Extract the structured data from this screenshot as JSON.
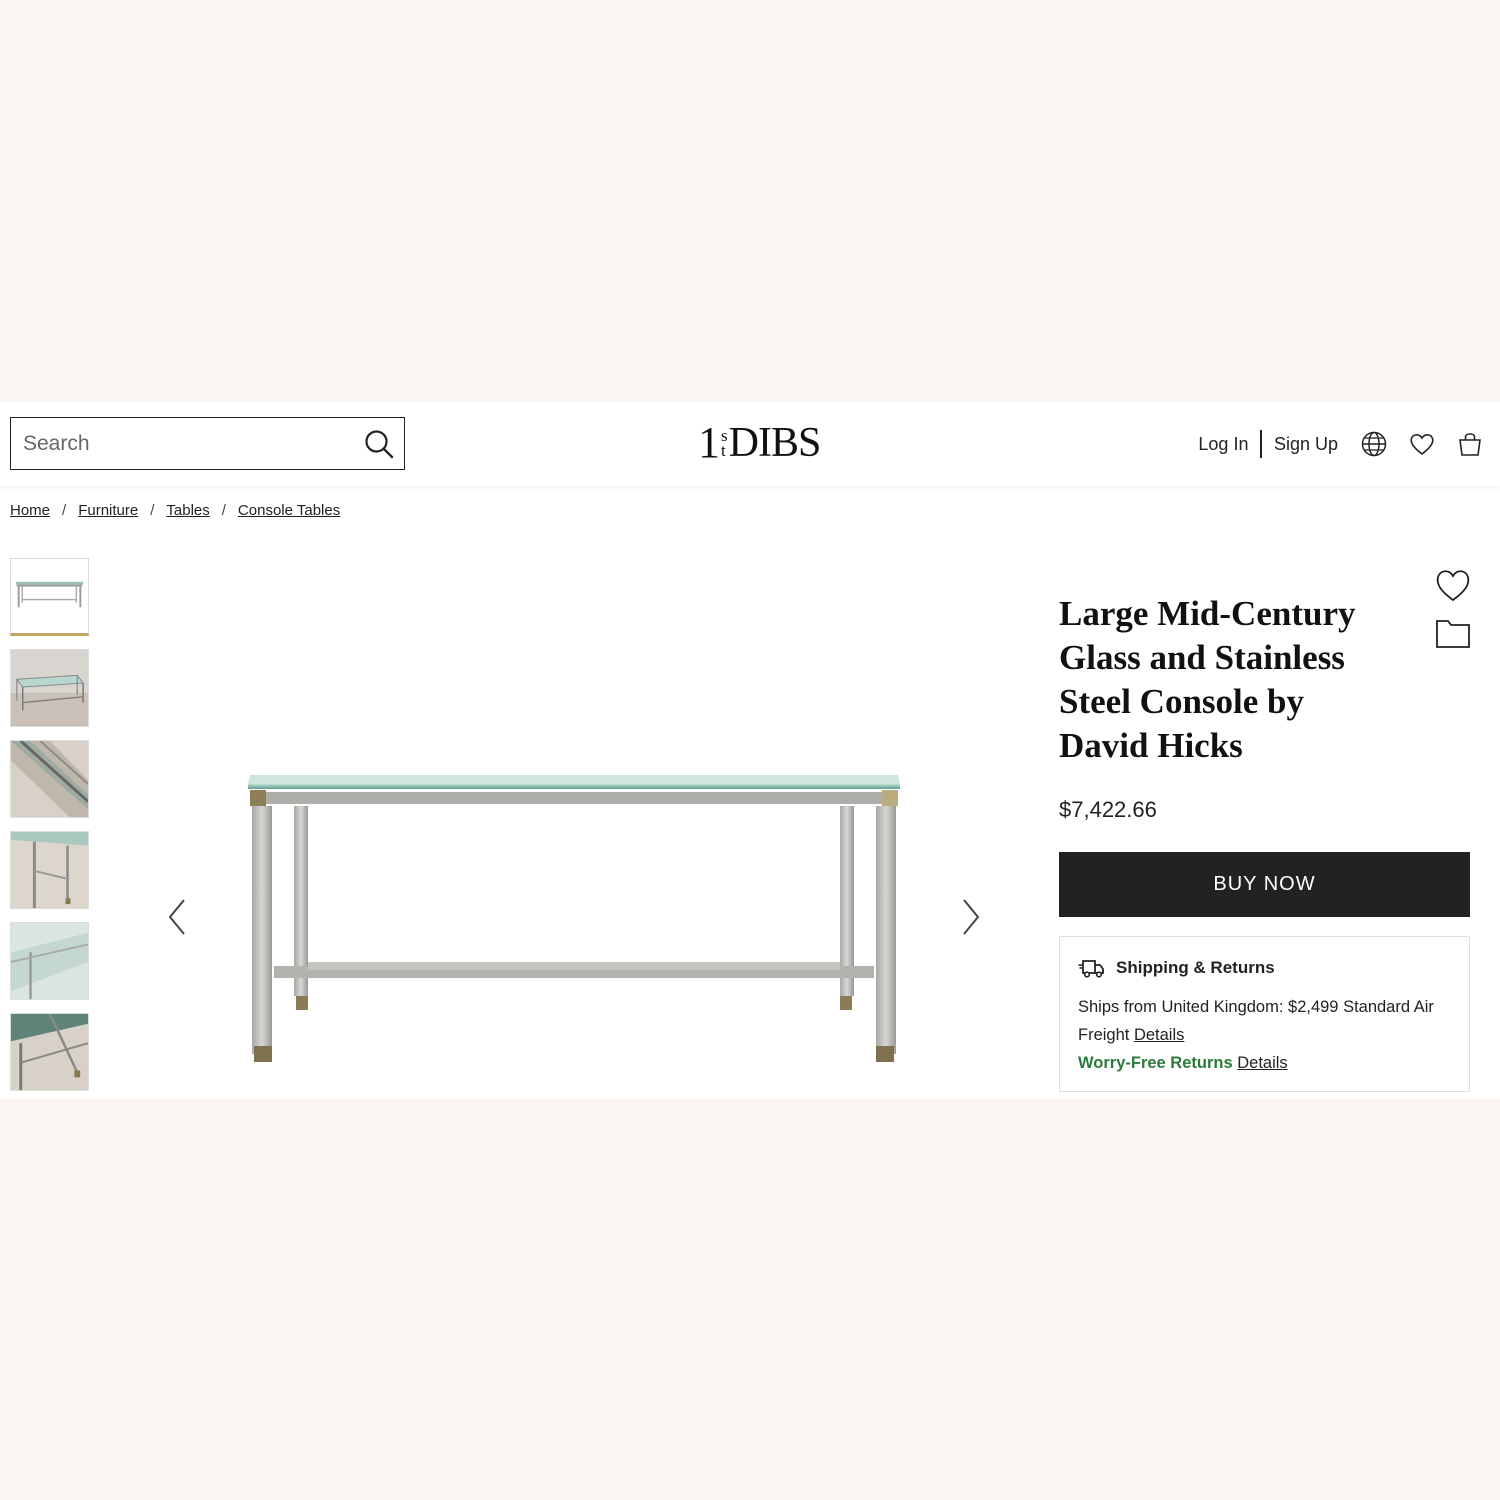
{
  "header": {
    "search_placeholder": "Search",
    "logo_one": "1",
    "logo_s": "s",
    "logo_t": "t",
    "logo_dibs": "DIBS",
    "login_label": "Log In",
    "signup_label": "Sign Up"
  },
  "breadcrumb": {
    "items": [
      "Home",
      "Furniture",
      "Tables",
      "Console Tables"
    ],
    "separator": "/"
  },
  "product": {
    "title": "Large Mid-Century Glass and Stainless Steel Console by David Hicks",
    "price": "$7,422.66",
    "buy_label": "BUY NOW"
  },
  "shipping": {
    "heading": "Shipping & Returns",
    "ship_text": "Ships from United Kingdom: $2,499 Standard Air Freight",
    "details_label": "Details",
    "returns_label": "Worry-Free Returns",
    "returns_details_label": "Details"
  },
  "colors": {
    "accent_gold": "#c2a661",
    "returns_green": "#2a7a3b",
    "button_dark": "#222222"
  },
  "thumbnails": [
    "thumb-1",
    "thumb-2",
    "thumb-3",
    "thumb-4",
    "thumb-5",
    "thumb-6"
  ],
  "icons": [
    "search-icon",
    "globe-icon",
    "heart-icon",
    "shopping-bag-icon",
    "folder-icon",
    "truck-icon",
    "chevron-left-icon",
    "chevron-right-icon"
  ]
}
